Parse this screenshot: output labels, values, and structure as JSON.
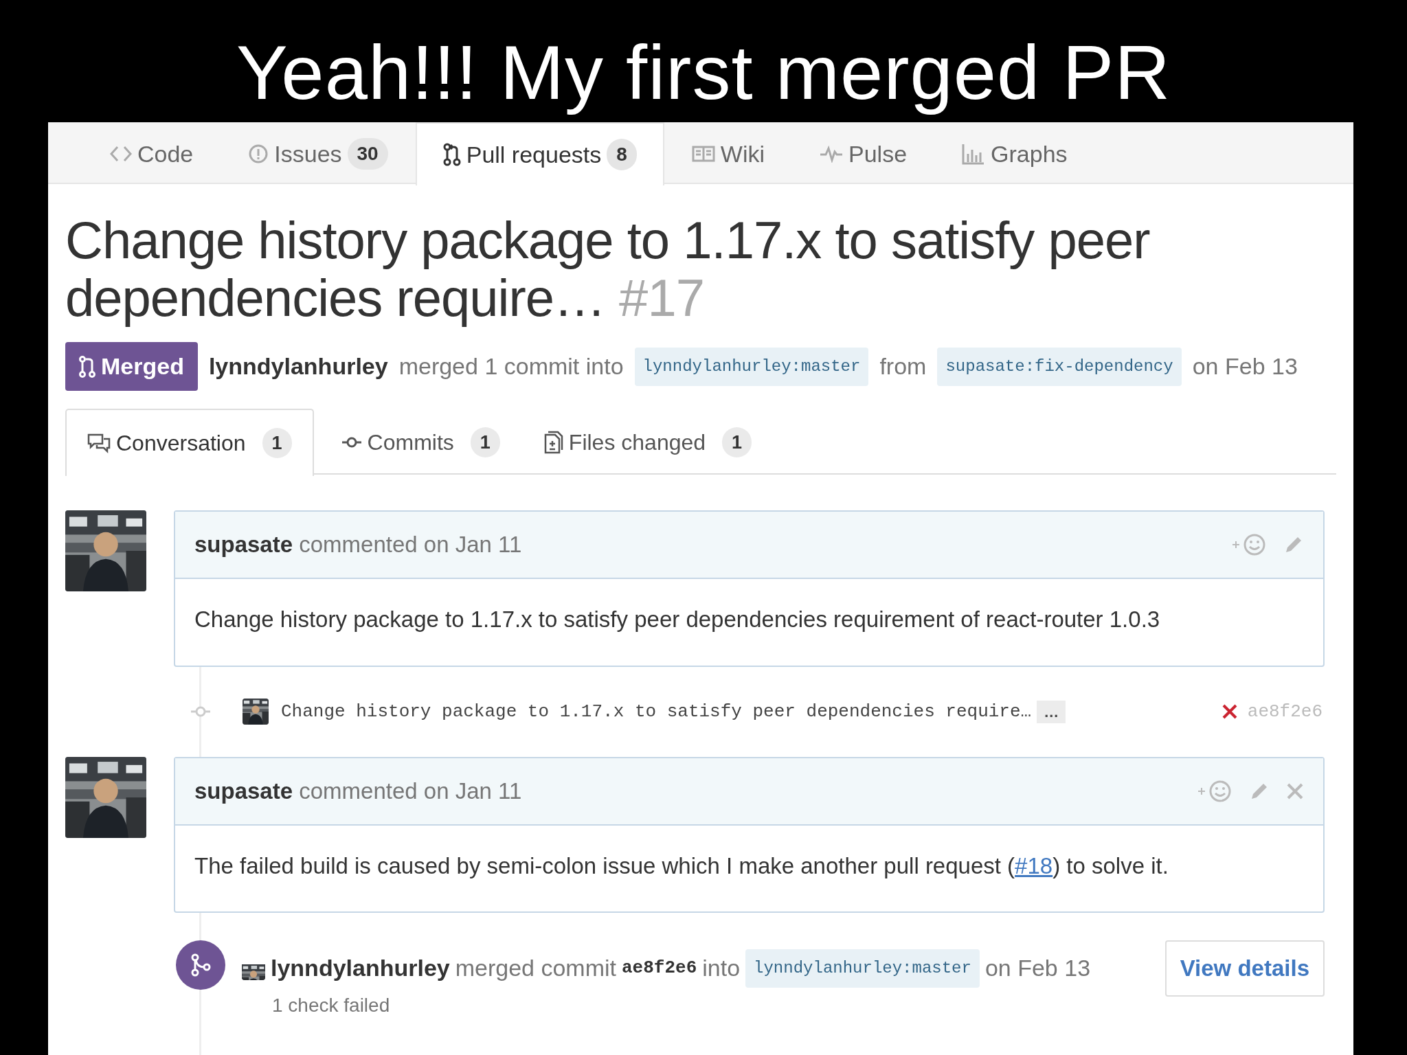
{
  "slide_title": "Yeah!!! My first merged PR",
  "repo_tabs": [
    {
      "label": "Code",
      "selected": false
    },
    {
      "label": "Issues",
      "count": "30",
      "selected": false
    },
    {
      "label": "Pull requests",
      "count": "8",
      "selected": true
    },
    {
      "label": "Wiki",
      "selected": false
    },
    {
      "label": "Pulse",
      "selected": false
    },
    {
      "label": "Graphs",
      "selected": false
    }
  ],
  "pr": {
    "title": "Change history package to 1.17.x to satisfy peer dependencies require…",
    "number": "#17",
    "state": "Merged",
    "author": "lynndylanhurley",
    "action": "merged 1 commit into",
    "base_branch": "lynndylanhurley:master",
    "from": "from",
    "head_branch": "supasate:fix-dependency",
    "date": "on Feb 13"
  },
  "pr_tabs": [
    {
      "label": "Conversation",
      "count": "1",
      "selected": true
    },
    {
      "label": "Commits",
      "count": "1",
      "selected": false
    },
    {
      "label": "Files changed",
      "count": "1",
      "selected": false
    }
  ],
  "timeline": [
    {
      "kind": "comment",
      "author": "supasate",
      "meta": "commented on Jan 11",
      "deletable": false,
      "body": [
        {
          "text": "Change history package to 1.17.x to satisfy peer dependencies requirement of react-router 1.0.3"
        }
      ]
    },
    {
      "kind": "commit",
      "message": "Change history package to 1.17.x to satisfy peer dependencies require…",
      "more": "…",
      "failed": true,
      "sha": "ae8f2e6"
    },
    {
      "kind": "comment",
      "author": "supasate",
      "meta": "commented on Jan 11",
      "deletable": true,
      "body": [
        {
          "text": "The failed build is caused by semi-colon issue which I make another pull request ("
        },
        {
          "text": "#18",
          "link": true
        },
        {
          "text": ") to solve it."
        }
      ]
    },
    {
      "kind": "merge",
      "author": "lynndylanhurley",
      "action": "merged commit",
      "sha": "ae8f2e6",
      "into": "into",
      "branch": "lynndylanhurley:master",
      "date": "on Feb 13",
      "button": "View details",
      "status": "1 check failed"
    }
  ]
}
